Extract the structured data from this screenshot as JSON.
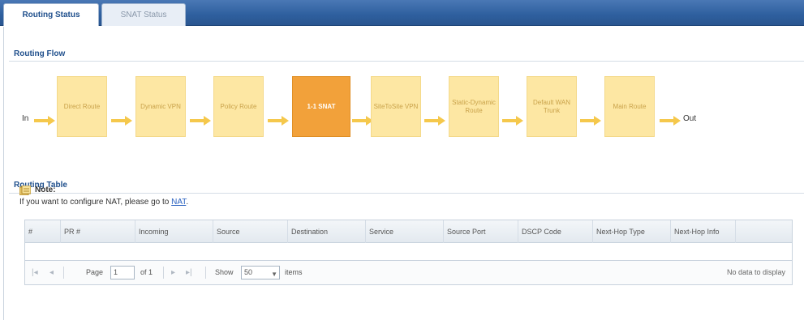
{
  "tabs": [
    {
      "label": "Routing Status"
    },
    {
      "label": "SNAT Status"
    }
  ],
  "routing_flow": {
    "title": "Routing Flow",
    "in_label": "In",
    "out_label": "Out",
    "steps": [
      {
        "label": "Direct Route"
      },
      {
        "label": "Dynamic VPN"
      },
      {
        "label": "Policy Route"
      },
      {
        "label": "1-1 SNAT"
      },
      {
        "label": "SiteToSite VPN"
      },
      {
        "label": "Static-Dynamic Route"
      },
      {
        "label": "Default WAN Trunk"
      },
      {
        "label": "Main Route"
      }
    ],
    "active_step_index": 3
  },
  "routing_table": {
    "title": "Routing Table",
    "note_title": "Note:",
    "note_text": "If you want to configure NAT, please go to ",
    "note_link": "NAT",
    "note_end": ".",
    "columns": [
      "#",
      "PR #",
      "Incoming",
      "Source",
      "Destination",
      "Service",
      "Source Port",
      "DSCP Code",
      "Next-Hop Type",
      "Next-Hop Info"
    ],
    "pager": {
      "first_icon": "first-page-icon",
      "prev_icon": "prev-page-icon",
      "page_label": "Page",
      "page_value": "1",
      "of_label": "of 1",
      "next_icon": "next-page-icon",
      "last_icon": "last-page-icon",
      "show_label": "Show",
      "show_value": "50",
      "items_label": "items",
      "empty_text": "No data to display"
    }
  },
  "colors": {
    "header_blue": "#2e5f9e",
    "flow_box": "#fde7a3",
    "flow_box_active": "#f2a13a",
    "arrow": "#f5c84c"
  }
}
